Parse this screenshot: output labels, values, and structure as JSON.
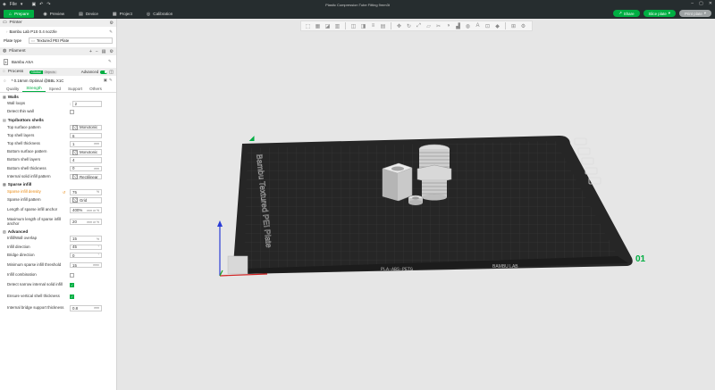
{
  "window": {
    "title": "Plastic Compression Tube Fitting 9mm3t",
    "file_menu": "File"
  },
  "tabs": [
    {
      "label": "Prepare",
      "icon": "home-icon",
      "active": true
    },
    {
      "label": "Preview",
      "icon": "preview-icon",
      "active": false
    },
    {
      "label": "Device",
      "icon": "device-icon",
      "active": false
    },
    {
      "label": "Project",
      "icon": "project-icon",
      "active": false
    },
    {
      "label": "Calibration",
      "icon": "calibration-icon",
      "active": false
    }
  ],
  "actions": {
    "share": "Share",
    "slice": "Slice plate",
    "print": "Print plate"
  },
  "printer": {
    "header": "Printer",
    "name": "Bambu Lab P1S 0.4 nozzle",
    "plate_type_label": "Plate type",
    "plate_type_value": "Textured PEI Plate"
  },
  "filament": {
    "header": "Filament",
    "slot": "1",
    "name": "Bambu ASA"
  },
  "process": {
    "header": "Process",
    "toggle_global": "Global",
    "toggle_objects": "Objects",
    "advanced_label": "Advanced",
    "preset": "* 0.16mm Optimal @BBL X1C"
  },
  "setting_tabs": [
    "Quality",
    "Strength",
    "Speed",
    "Support",
    "Others"
  ],
  "active_setting_tab": "Strength",
  "groups": {
    "walls": {
      "title": "Walls",
      "wall_loops_label": "Wall loops",
      "wall_loops_value": "2",
      "detect_thin_wall_label": "Detect thin wall"
    },
    "top_bottom": {
      "title": "Top/bottom shells",
      "top_surface_pattern_label": "Top surface pattern",
      "top_surface_pattern_value": "Monotonic",
      "top_shell_layers_label": "Top shell layers",
      "top_shell_layers_value": "6",
      "top_shell_thickness_label": "Top shell thickness",
      "top_shell_thickness_value": "1",
      "top_shell_thickness_unit": "mm",
      "bottom_surface_pattern_label": "Bottom surface pattern",
      "bottom_surface_pattern_value": "Monotonic",
      "bottom_shell_layers_label": "Bottom shell layers",
      "bottom_shell_layers_value": "4",
      "bottom_shell_thickness_label": "Bottom shell thickness",
      "bottom_shell_thickness_value": "0",
      "bottom_shell_thickness_unit": "mm",
      "internal_solid_infill_label": "Internal solid infill pattern",
      "internal_solid_infill_value": "Rectilinear"
    },
    "sparse_infill": {
      "title": "Sparse infill",
      "density_label": "Sparse infill density",
      "density_value": "75",
      "density_unit": "%",
      "pattern_label": "Sparse infill pattern",
      "pattern_value": "Grid",
      "anchor_label": "Length of sparse infill anchor",
      "anchor_value": "400%",
      "anchor_unit": "mm or %",
      "max_anchor_label": "Maximum length of sparse infill anchor",
      "max_anchor_value": "20",
      "max_anchor_unit": "mm or %"
    },
    "advanced": {
      "title": "Advanced",
      "overlap_label": "Infill/Wall overlap",
      "overlap_value": "15",
      "overlap_unit": "%",
      "infill_direction_label": "Infill direction",
      "infill_direction_value": "45",
      "infill_direction_unit": "°",
      "bridge_direction_label": "Bridge direction",
      "bridge_direction_value": "0",
      "bridge_direction_unit": "°",
      "min_sparse_label": "Minimum sparse infill threshold",
      "min_sparse_value": "15",
      "min_sparse_unit": "mm²",
      "infill_combination_label": "Infill combination",
      "detect_narrow_label": "Detect narrow internal solid infill",
      "ensure_vertical_label": "Ensure vertical shell thickness",
      "bridge_support_label": "Internal bridge support thickness",
      "bridge_support_value": "0.8",
      "bridge_support_unit": "mm"
    }
  },
  "plate": {
    "side_text": "Bambu Textured PEI Plate",
    "front_label": "PLA-ABS-PETG",
    "front_brand": "BAMBU LAB",
    "plate_number": "01"
  },
  "colors": {
    "accent": "#00ae42",
    "topbar": "#262d2f",
    "plate": "#2b2b2b",
    "orange": "#e8870c"
  }
}
